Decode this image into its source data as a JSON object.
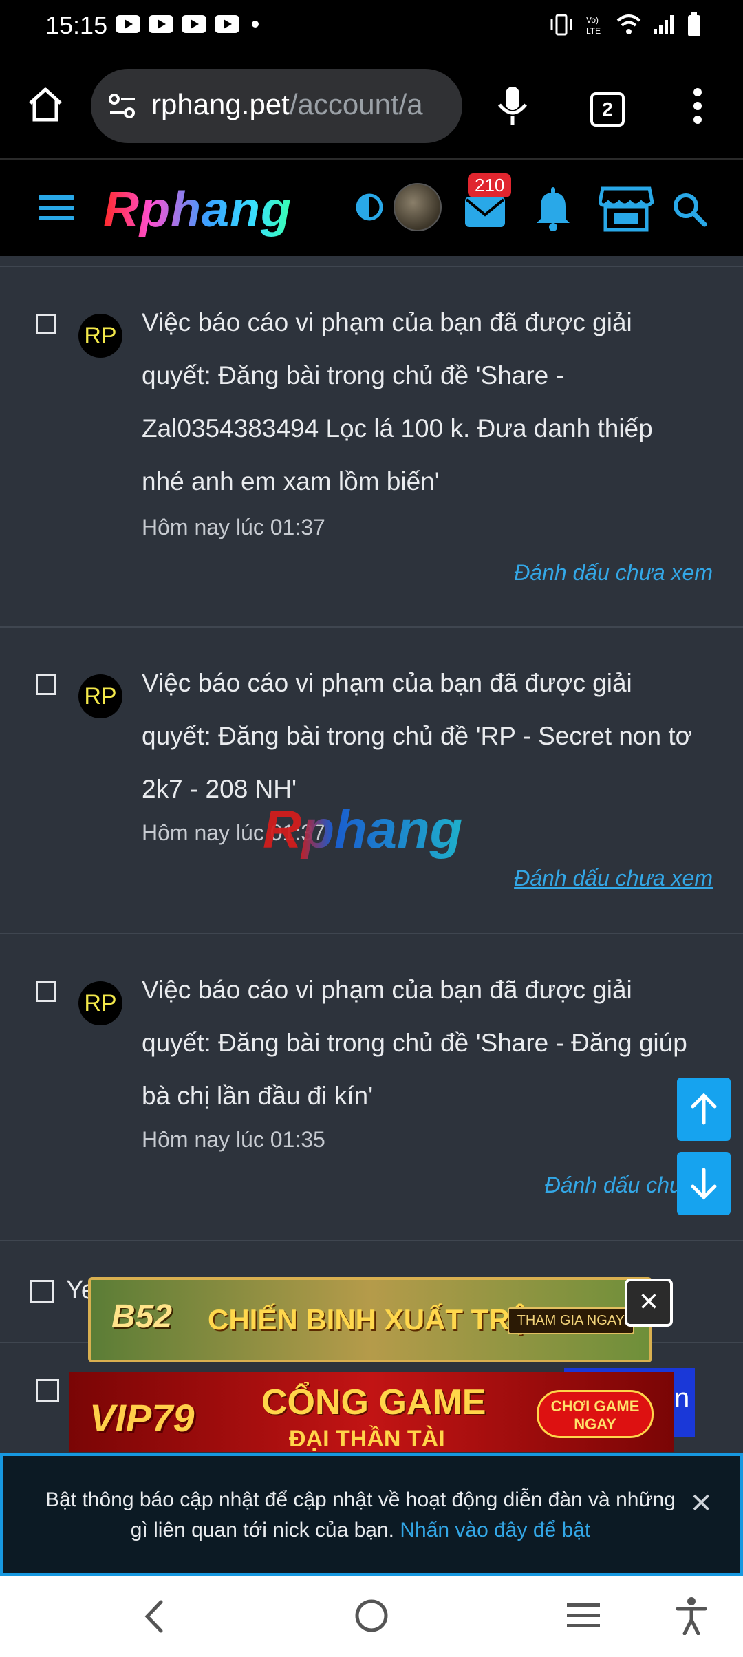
{
  "status_bar": {
    "time": "15:15"
  },
  "browser": {
    "url_host": "rphang.pet",
    "url_path": "/account/a",
    "tab_count": "2"
  },
  "site_header": {
    "logo_text": "Rphang",
    "inbox_badge": "210"
  },
  "notifications": [
    {
      "avatar": "RP",
      "line1": "Việc báo cáo vi phạm của bạn đã được giải",
      "line2": "quyết: Đăng bài trong chủ đề 'Share -",
      "line3": "Zal0354383494 Lọc lá 100 k. Đưa danh thiếp",
      "line4": "nhé anh em xam lồm biến'",
      "time": "Hôm nay lúc 01:37",
      "action": "Đánh dấu chưa xem"
    },
    {
      "avatar": "RP",
      "line1": "Việc báo cáo vi phạm của bạn đã được giải",
      "line2": "quyết: Đăng bài trong chủ đề 'RP - Secret non tơ",
      "line3": "2k7 - 208 NH'",
      "time": "Hôm nay lúc 01:37",
      "action": "Đánh dấu chưa xem"
    },
    {
      "avatar": "RP",
      "line1": "Việc báo cáo vi phạm của bạn đã được giải",
      "line2": "quyết: Đăng bài trong chủ đề 'Share - Đăng giúp",
      "line3": "bà chị lần đầu đi kín'",
      "time": "Hôm nay lúc 01:35",
      "action": "Đánh dấu chưa x"
    }
  ],
  "partial_row": {
    "label": "Ye"
  },
  "watermark": "Rphang",
  "ads": {
    "ad1_brand": "B52",
    "ad1_title": "CHIẾN BINH XUẤT TRẬN",
    "ad1_cta": "THAM GIA NGAY",
    "ad1_close": "×",
    "ad2_brand": "VIP79",
    "ad2_title": "CỔNG GAME",
    "ad2_subtitle": "ĐẠI THẦN TÀI",
    "ad2_cta": "CHƠI GAME NGAY",
    "ad2_edge": "n"
  },
  "notice": {
    "text": "Bật thông báo cập nhật để cập nhật về hoạt động diễn đàn và những gì liên quan tới nick của bạn.",
    "link": "Nhấn vào đây để bật",
    "close": "✕"
  },
  "colors": {
    "accent": "#33a7e6",
    "fab": "#16a3ef",
    "badge": "#e0262f",
    "bg": "#2d333c"
  }
}
